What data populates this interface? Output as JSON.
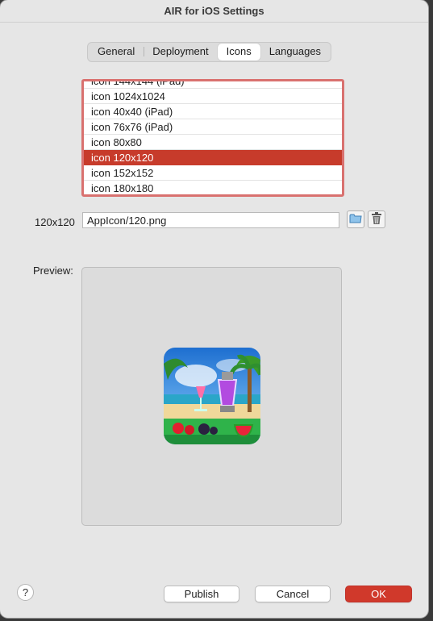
{
  "window": {
    "title": "AIR for iOS Settings"
  },
  "tabs": [
    {
      "label": "General",
      "active": false
    },
    {
      "label": "Deployment",
      "active": false
    },
    {
      "label": "Icons",
      "active": true
    },
    {
      "label": "Languages",
      "active": false
    }
  ],
  "icon_list": {
    "items": [
      "icon 144x144 (iPad)",
      "icon 1024x1024",
      "icon 40x40 (iPad)",
      "icon 76x76 (iPad)",
      "icon 80x80",
      "icon 120x120",
      "icon 152x152",
      "icon 180x180"
    ],
    "selected": "icon 120x120"
  },
  "icon_path": {
    "label": "120x120",
    "value": "AppIcon/120.png",
    "browse_icon": "folder-icon",
    "delete_icon": "trash-icon"
  },
  "preview": {
    "label": "Preview:"
  },
  "footer": {
    "help_label": "?",
    "publish_label": "Publish",
    "cancel_label": "Cancel",
    "ok_label": "OK"
  },
  "colors": {
    "accent": "#d0392b",
    "selection": "#c73b2b",
    "focus_ring": "#d9716f"
  }
}
